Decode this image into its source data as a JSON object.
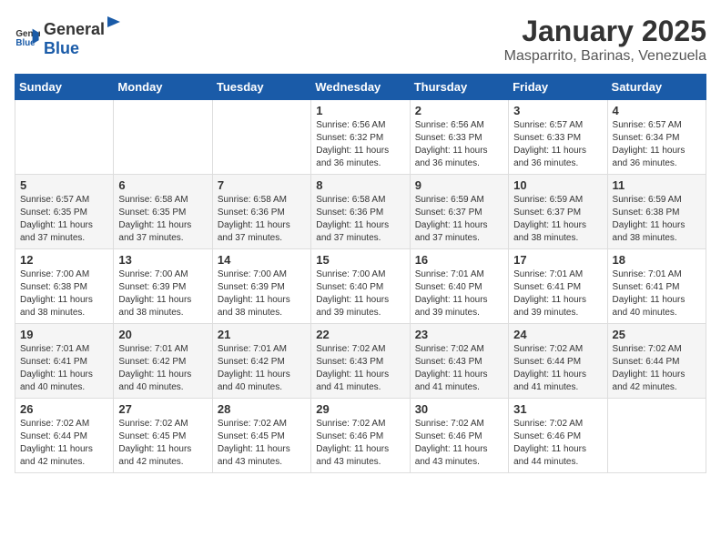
{
  "header": {
    "logo_general": "General",
    "logo_blue": "Blue",
    "title": "January 2025",
    "location": "Masparrito, Barinas, Venezuela"
  },
  "days_of_week": [
    "Sunday",
    "Monday",
    "Tuesday",
    "Wednesday",
    "Thursday",
    "Friday",
    "Saturday"
  ],
  "weeks": [
    [
      {
        "day": "",
        "info": ""
      },
      {
        "day": "",
        "info": ""
      },
      {
        "day": "",
        "info": ""
      },
      {
        "day": "1",
        "info": "Sunrise: 6:56 AM\nSunset: 6:32 PM\nDaylight: 11 hours and 36 minutes."
      },
      {
        "day": "2",
        "info": "Sunrise: 6:56 AM\nSunset: 6:33 PM\nDaylight: 11 hours and 36 minutes."
      },
      {
        "day": "3",
        "info": "Sunrise: 6:57 AM\nSunset: 6:33 PM\nDaylight: 11 hours and 36 minutes."
      },
      {
        "day": "4",
        "info": "Sunrise: 6:57 AM\nSunset: 6:34 PM\nDaylight: 11 hours and 36 minutes."
      }
    ],
    [
      {
        "day": "5",
        "info": "Sunrise: 6:57 AM\nSunset: 6:35 PM\nDaylight: 11 hours and 37 minutes."
      },
      {
        "day": "6",
        "info": "Sunrise: 6:58 AM\nSunset: 6:35 PM\nDaylight: 11 hours and 37 minutes."
      },
      {
        "day": "7",
        "info": "Sunrise: 6:58 AM\nSunset: 6:36 PM\nDaylight: 11 hours and 37 minutes."
      },
      {
        "day": "8",
        "info": "Sunrise: 6:58 AM\nSunset: 6:36 PM\nDaylight: 11 hours and 37 minutes."
      },
      {
        "day": "9",
        "info": "Sunrise: 6:59 AM\nSunset: 6:37 PM\nDaylight: 11 hours and 37 minutes."
      },
      {
        "day": "10",
        "info": "Sunrise: 6:59 AM\nSunset: 6:37 PM\nDaylight: 11 hours and 38 minutes."
      },
      {
        "day": "11",
        "info": "Sunrise: 6:59 AM\nSunset: 6:38 PM\nDaylight: 11 hours and 38 minutes."
      }
    ],
    [
      {
        "day": "12",
        "info": "Sunrise: 7:00 AM\nSunset: 6:38 PM\nDaylight: 11 hours and 38 minutes."
      },
      {
        "day": "13",
        "info": "Sunrise: 7:00 AM\nSunset: 6:39 PM\nDaylight: 11 hours and 38 minutes."
      },
      {
        "day": "14",
        "info": "Sunrise: 7:00 AM\nSunset: 6:39 PM\nDaylight: 11 hours and 38 minutes."
      },
      {
        "day": "15",
        "info": "Sunrise: 7:00 AM\nSunset: 6:40 PM\nDaylight: 11 hours and 39 minutes."
      },
      {
        "day": "16",
        "info": "Sunrise: 7:01 AM\nSunset: 6:40 PM\nDaylight: 11 hours and 39 minutes."
      },
      {
        "day": "17",
        "info": "Sunrise: 7:01 AM\nSunset: 6:41 PM\nDaylight: 11 hours and 39 minutes."
      },
      {
        "day": "18",
        "info": "Sunrise: 7:01 AM\nSunset: 6:41 PM\nDaylight: 11 hours and 40 minutes."
      }
    ],
    [
      {
        "day": "19",
        "info": "Sunrise: 7:01 AM\nSunset: 6:41 PM\nDaylight: 11 hours and 40 minutes."
      },
      {
        "day": "20",
        "info": "Sunrise: 7:01 AM\nSunset: 6:42 PM\nDaylight: 11 hours and 40 minutes."
      },
      {
        "day": "21",
        "info": "Sunrise: 7:01 AM\nSunset: 6:42 PM\nDaylight: 11 hours and 40 minutes."
      },
      {
        "day": "22",
        "info": "Sunrise: 7:02 AM\nSunset: 6:43 PM\nDaylight: 11 hours and 41 minutes."
      },
      {
        "day": "23",
        "info": "Sunrise: 7:02 AM\nSunset: 6:43 PM\nDaylight: 11 hours and 41 minutes."
      },
      {
        "day": "24",
        "info": "Sunrise: 7:02 AM\nSunset: 6:44 PM\nDaylight: 11 hours and 41 minutes."
      },
      {
        "day": "25",
        "info": "Sunrise: 7:02 AM\nSunset: 6:44 PM\nDaylight: 11 hours and 42 minutes."
      }
    ],
    [
      {
        "day": "26",
        "info": "Sunrise: 7:02 AM\nSunset: 6:44 PM\nDaylight: 11 hours and 42 minutes."
      },
      {
        "day": "27",
        "info": "Sunrise: 7:02 AM\nSunset: 6:45 PM\nDaylight: 11 hours and 42 minutes."
      },
      {
        "day": "28",
        "info": "Sunrise: 7:02 AM\nSunset: 6:45 PM\nDaylight: 11 hours and 43 minutes."
      },
      {
        "day": "29",
        "info": "Sunrise: 7:02 AM\nSunset: 6:46 PM\nDaylight: 11 hours and 43 minutes."
      },
      {
        "day": "30",
        "info": "Sunrise: 7:02 AM\nSunset: 6:46 PM\nDaylight: 11 hours and 43 minutes."
      },
      {
        "day": "31",
        "info": "Sunrise: 7:02 AM\nSunset: 6:46 PM\nDaylight: 11 hours and 44 minutes."
      },
      {
        "day": "",
        "info": ""
      }
    ]
  ]
}
